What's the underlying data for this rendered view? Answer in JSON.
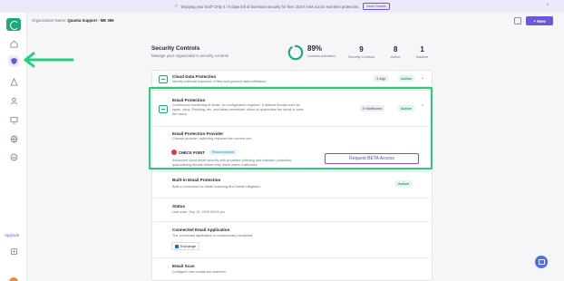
{
  "banner": {
    "message": "Enjoying your trial? Only 4 / 5 days left of dominant security for free. Don't miss out on real time protection.",
    "details_label": "More Details",
    "close_glyph": "×"
  },
  "header": {
    "org_label": "Organization Name:",
    "org_name": "Quanta Support - ME 369",
    "new_label": "+ New"
  },
  "sidebar": {
    "icons": [
      "home-icon",
      "shield-icon",
      "alert-icon",
      "user-icon",
      "monitor-icon",
      "globe-icon",
      "layers-icon"
    ],
    "upgrade_label": "Upgrade",
    "avatar_initial": "Q"
  },
  "security": {
    "title": "Security Controls",
    "subtitle": "Manage your organization's security controls",
    "percent": "89%",
    "percent_value": 0.89,
    "percent_label": "Controls Activated",
    "stats": [
      {
        "value": "9",
        "label": "Security Controls"
      },
      {
        "value": "8",
        "label": "Active"
      },
      {
        "value": "1",
        "label": "Inactive"
      }
    ]
  },
  "cards": {
    "cloud": {
      "title": "Cloud Data Protection",
      "desc": "Identify external exposure of files and prevent data exfiltration.",
      "count": "1 App",
      "status": "Active"
    },
    "email": {
      "title": "Email Protection",
      "desc1": "Continuous monitoring of email, no configuration required. It detects threats such as",
      "desc2": "spam, virus, Phishing, etc. and takes immediate action to quarantine the email or warn",
      "desc3": "the users.",
      "count": "0 Mailboxes",
      "status": "Active"
    },
    "provider": {
      "title": "Email Protection Provider",
      "desc": "Choose provider, switching replaces the current one",
      "vendor": "CHECK POINT",
      "badge": "Recommended",
      "vendor_desc1": "Advanced cloud email security with proactive phishing and malware protection,",
      "vendor_desc2": "quarantining threats before they reach users' mailboxes.",
      "beta_label": "Request BETA Access"
    },
    "builtin": {
      "title": "Built-in Email Protection",
      "desc": "Built-in protection for email scanning and threat mitigation.",
      "status": "Active"
    },
    "status": {
      "title": "Status",
      "desc": "Last scan: Sep 15, 2025 09:54 pm"
    },
    "connected": {
      "title": "Connected Email Application",
      "desc": "The connected application is continuously monitored.",
      "app": "Exchange"
    },
    "scan": {
      "title": "Email Scan",
      "desc": "Configure new emails are scanned."
    }
  },
  "colors": {
    "accent": "#6c58d6",
    "brand_green": "#1fa97a",
    "highlight": "#22d07a"
  }
}
